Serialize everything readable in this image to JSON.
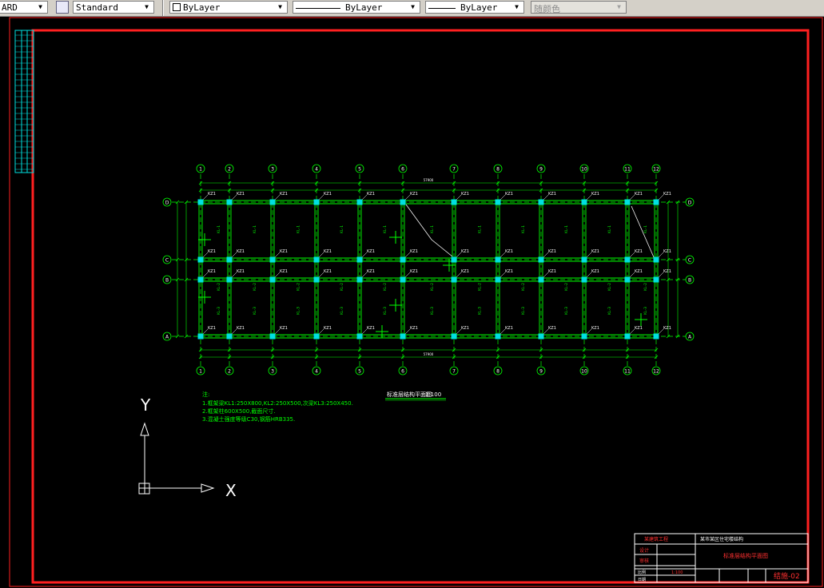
{
  "toolbar": {
    "text_style_fragment": "ARD",
    "dim_style": "Standard",
    "layer": "ByLayer",
    "linetype": "ByLayer",
    "lineweight": "ByLayer",
    "plot_style": "随颜色"
  },
  "grid": {
    "top_labels": [
      "1",
      "2",
      "3",
      "4",
      "5",
      "6",
      "7",
      "8",
      "9",
      "10",
      "11",
      "12"
    ],
    "bottom_labels": [
      "1",
      "2",
      "3",
      "4",
      "5",
      "6",
      "7",
      "8",
      "9",
      "10",
      "11",
      "12"
    ],
    "row_labels": [
      "D",
      "C",
      "B",
      "A"
    ],
    "total_dimension": "57900",
    "column_label": "KZ1",
    "beam_labels": [
      "KL-1",
      "KL-2",
      "KL-3"
    ]
  },
  "plan_title": {
    "name": "标准层结构平面图",
    "scale": "1:100"
  },
  "notes": {
    "heading": "注:",
    "lines": [
      "1.框架梁KL1:250X800,KL2:250X500,次梁KL3:250X450.",
      "2.框架柱600X500,截面尺寸.",
      "3.混凝土强度等级C30,钢筋HRB335."
    ]
  },
  "ucs": {
    "y_label": "Y",
    "x_label": "X"
  },
  "title_block": {
    "company": "某建筑工程",
    "project": "某市某区住宅楼结构",
    "drawing_name": "标准层结构平面图",
    "designer_label": "设计",
    "checker_label": "审核",
    "scale_label": "比例",
    "scale_value": "1:100",
    "date_label": "日期",
    "drawing_no": "结施-02"
  },
  "colors": {
    "background": "#000000",
    "border": "#ff0000",
    "grid_lines": "#00ff00",
    "columns": "#00e0e0",
    "text": "#ffffff"
  }
}
